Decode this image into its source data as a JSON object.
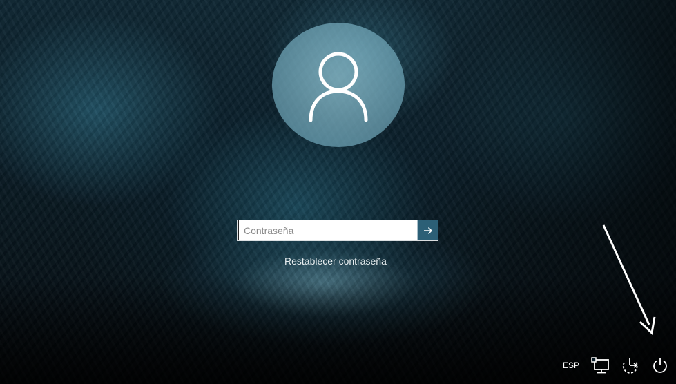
{
  "login": {
    "password_placeholder": "Contraseña",
    "password_value": "",
    "reset_link": "Restablecer contraseña"
  },
  "tray": {
    "language": "ESP",
    "icons": [
      "network-icon",
      "ease-of-access-icon",
      "power-icon"
    ]
  },
  "icons": {
    "avatar": "user-icon",
    "submit": "arrow-right-icon",
    "annotation": "arrow-pointer"
  },
  "colors": {
    "submit_button": "#2c5f76",
    "avatar_circle": "#7fb0c2",
    "text": "#ffffff"
  }
}
